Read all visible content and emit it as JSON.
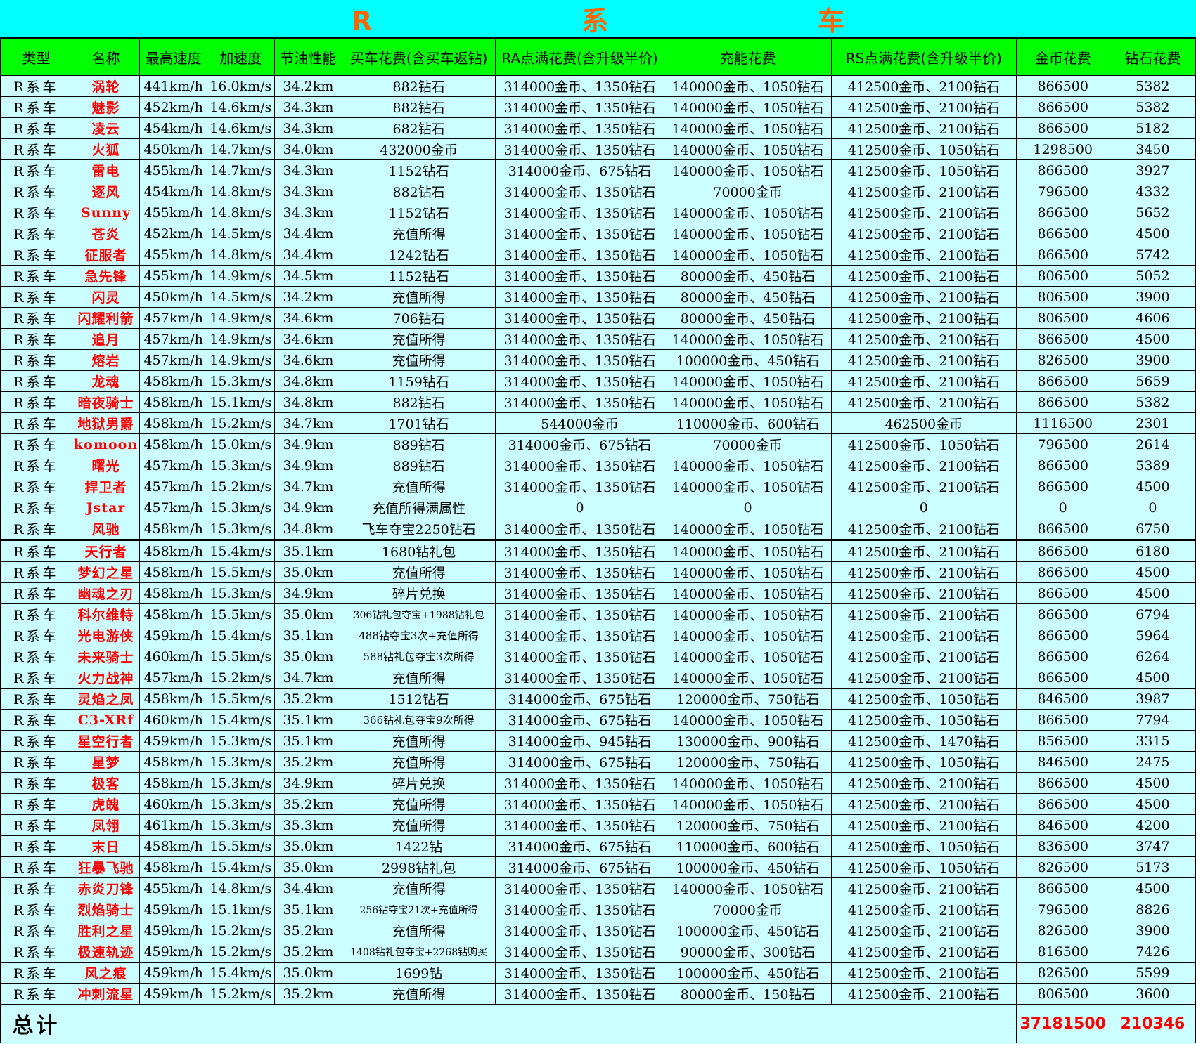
{
  "sheet": {
    "title": "R　系　车",
    "columns": [
      "类型",
      "名称",
      "最高速度",
      "加速度",
      "节油性能",
      "买车花费(含买车返钻)",
      "RA点满花费(含升级半价)",
      "充能花费",
      "RS点满花费(含升级半价)",
      "金币花费",
      "钻石花费"
    ],
    "rows": [
      {
        "type": "R系车",
        "name": "涡轮",
        "speed": "441km/h",
        "accel": "16.0km/s",
        "fuel": "34.2km",
        "buy": "882钻石",
        "ra": "314000金币、1350钻石",
        "charge": "140000金币、1050钻石",
        "rs": "412500金币、2100钻石",
        "gold": "866500",
        "diamond": "5382"
      },
      {
        "type": "R系车",
        "name": "魅影",
        "speed": "452km/h",
        "accel": "14.6km/s",
        "fuel": "34.3km",
        "buy": "882钻石",
        "ra": "314000金币、1350钻石",
        "charge": "140000金币、1050钻石",
        "rs": "412500金币、2100钻石",
        "gold": "866500",
        "diamond": "5382"
      },
      {
        "type": "R系车",
        "name": "凌云",
        "speed": "454km/h",
        "accel": "14.6km/s",
        "fuel": "34.3km",
        "buy": "682钻石",
        "ra": "314000金币、1350钻石",
        "charge": "140000金币、1050钻石",
        "rs": "412500金币、2100钻石",
        "gold": "866500",
        "diamond": "5182"
      },
      {
        "type": "R系车",
        "name": "火狐",
        "speed": "450km/h",
        "accel": "14.7km/s",
        "fuel": "34.0km",
        "buy": "432000金币",
        "ra": "314000金币、1350钻石",
        "charge": "140000金币、1050钻石",
        "rs": "412500金币、1050钻石",
        "gold": "1298500",
        "diamond": "3450"
      },
      {
        "type": "R系车",
        "name": "雷电",
        "speed": "455km/h",
        "accel": "14.7km/s",
        "fuel": "34.3km",
        "buy": "1152钻石",
        "ra": "314000金币、675钻石",
        "charge": "140000金币、1050钻石",
        "rs": "412500金币、1050钻石",
        "gold": "866500",
        "diamond": "3927"
      },
      {
        "type": "R系车",
        "name": "逐风",
        "speed": "454km/h",
        "accel": "14.8km/s",
        "fuel": "34.3km",
        "buy": "882钻石",
        "ra": "314000金币、1350钻石",
        "charge": "70000金币",
        "rs": "412500金币、2100钻石",
        "gold": "796500",
        "diamond": "4332"
      },
      {
        "type": "R系车",
        "name": "Sunny",
        "speed": "455km/h",
        "accel": "14.8km/s",
        "fuel": "34.3km",
        "buy": "1152钻石",
        "ra": "314000金币、1350钻石",
        "charge": "140000金币、1050钻石",
        "rs": "412500金币、2100钻石",
        "gold": "866500",
        "diamond": "5652"
      },
      {
        "type": "R系车",
        "name": "苍炎",
        "speed": "452km/h",
        "accel": "14.5km/s",
        "fuel": "34.4km",
        "buy": "充值所得",
        "ra": "314000金币、1350钻石",
        "charge": "140000金币、1050钻石",
        "rs": "412500金币、2100钻石",
        "gold": "866500",
        "diamond": "4500"
      },
      {
        "type": "R系车",
        "name": "征服者",
        "speed": "455km/h",
        "accel": "14.8km/s",
        "fuel": "34.4km",
        "buy": "1242钻石",
        "ra": "314000金币、1350钻石",
        "charge": "140000金币、1050钻石",
        "rs": "412500金币、2100钻石",
        "gold": "866500",
        "diamond": "5742"
      },
      {
        "type": "R系车",
        "name": "急先锋",
        "speed": "455km/h",
        "accel": "14.9km/s",
        "fuel": "34.5km",
        "buy": "1152钻石",
        "ra": "314000金币、1350钻石",
        "charge": "80000金币、450钻石",
        "rs": "412500金币、2100钻石",
        "gold": "806500",
        "diamond": "5052"
      },
      {
        "type": "R系车",
        "name": "闪灵",
        "speed": "450km/h",
        "accel": "14.5km/s",
        "fuel": "34.2km",
        "buy": "充值所得",
        "ra": "314000金币、1350钻石",
        "charge": "80000金币、450钻石",
        "rs": "412500金币、2100钻石",
        "gold": "806500",
        "diamond": "3900"
      },
      {
        "type": "R系车",
        "name": "闪耀利箭",
        "speed": "457km/h",
        "accel": "14.9km/s",
        "fuel": "34.6km",
        "buy": "706钻石",
        "ra": "314000金币、1350钻石",
        "charge": "80000金币、450钻石",
        "rs": "412500金币、2100钻石",
        "gold": "806500",
        "diamond": "4606"
      },
      {
        "type": "R系车",
        "name": "追月",
        "speed": "457km/h",
        "accel": "14.9km/s",
        "fuel": "34.6km",
        "buy": "充值所得",
        "ra": "314000金币、1350钻石",
        "charge": "140000金币、1050钻石",
        "rs": "412500金币、2100钻石",
        "gold": "866500",
        "diamond": "4500"
      },
      {
        "type": "R系车",
        "name": "熔岩",
        "speed": "457km/h",
        "accel": "14.9km/s",
        "fuel": "34.6km",
        "buy": "充值所得",
        "ra": "314000金币、1350钻石",
        "charge": "100000金币、450钻石",
        "rs": "412500金币、2100钻石",
        "gold": "826500",
        "diamond": "3900"
      },
      {
        "type": "R系车",
        "name": "龙魂",
        "speed": "458km/h",
        "accel": "15.3km/s",
        "fuel": "34.8km",
        "buy": "1159钻石",
        "ra": "314000金币、1350钻石",
        "charge": "140000金币、1050钻石",
        "rs": "412500金币、2100钻石",
        "gold": "866500",
        "diamond": "5659"
      },
      {
        "type": "R系车",
        "name": "暗夜骑士",
        "speed": "458km/h",
        "accel": "15.1km/s",
        "fuel": "34.8km",
        "buy": "882钻石",
        "ra": "314000金币、1350钻石",
        "charge": "140000金币、1050钻石",
        "rs": "412500金币、2100钻石",
        "gold": "866500",
        "diamond": "5382"
      },
      {
        "type": "R系车",
        "name": "地狱男爵",
        "speed": "458km/h",
        "accel": "15.2km/s",
        "fuel": "34.7km",
        "buy": "1701钻石",
        "ra": "544000金币",
        "charge": "110000金币、600钻石",
        "rs": "462500金币",
        "gold": "1116500",
        "diamond": "2301"
      },
      {
        "type": "R系车",
        "name": "komoon",
        "speed": "458km/h",
        "accel": "15.0km/s",
        "fuel": "34.9km",
        "buy": "889钻石",
        "ra": "314000金币、675钻石",
        "charge": "70000金币",
        "rs": "412500金币、1050钻石",
        "gold": "796500",
        "diamond": "2614"
      },
      {
        "type": "R系车",
        "name": "曙光",
        "speed": "457km/h",
        "accel": "15.3km/s",
        "fuel": "34.9km",
        "buy": "889钻石",
        "ra": "314000金币、1350钻石",
        "charge": "140000金币、1050钻石",
        "rs": "412500金币、2100钻石",
        "gold": "866500",
        "diamond": "5389"
      },
      {
        "type": "R系车",
        "name": "捍卫者",
        "speed": "457km/h",
        "accel": "15.2km/s",
        "fuel": "34.7km",
        "buy": "充值所得",
        "ra": "314000金币、1350钻石",
        "charge": "140000金币、1050钻石",
        "rs": "412500金币、2100钻石",
        "gold": "866500",
        "diamond": "4500"
      },
      {
        "type": "R系车",
        "name": "Jstar",
        "speed": "457km/h",
        "accel": "15.3km/s",
        "fuel": "34.9km",
        "buy": "充值所得满属性",
        "ra": "0",
        "charge": "0",
        "rs": "0",
        "gold": "0",
        "diamond": "0"
      },
      {
        "type": "R系车",
        "name": "风驰",
        "speed": "458km/h",
        "accel": "15.3km/s",
        "fuel": "34.8km",
        "buy": "飞车夺宝2250钻石",
        "ra": "314000金币、1350钻石",
        "charge": "140000金币、1050钻石",
        "rs": "412500金币、2100钻石",
        "gold": "866500",
        "diamond": "6750"
      },
      {
        "type": "R系车",
        "name": "天行者",
        "speed": "458km/h",
        "accel": "15.4km/s",
        "fuel": "35.1km",
        "buy": "1680钻礼包",
        "ra": "314000金币、1350钻石",
        "charge": "140000金币、1050钻石",
        "rs": "412500金币、2100钻石",
        "gold": "866500",
        "diamond": "6180"
      },
      {
        "type": "R系车",
        "name": "梦幻之星",
        "speed": "458km/h",
        "accel": "15.5km/s",
        "fuel": "35.0km",
        "buy": "充值所得",
        "ra": "314000金币、1350钻石",
        "charge": "140000金币、1050钻石",
        "rs": "412500金币、2100钻石",
        "gold": "866500",
        "diamond": "4500"
      },
      {
        "type": "R系车",
        "name": "幽魂之刃",
        "speed": "458km/h",
        "accel": "15.3km/s",
        "fuel": "34.9km",
        "buy": "碎片兑换",
        "ra": "314000金币、1350钻石",
        "charge": "140000金币、1050钻石",
        "rs": "412500金币、2100钻石",
        "gold": "866500",
        "diamond": "4500"
      },
      {
        "type": "R系车",
        "name": "科尔维特",
        "speed": "458km/h",
        "accel": "15.5km/s",
        "fuel": "35.0km",
        "buy": "306钻礼包夺宝+1988钻礼包",
        "ra": "314000金币、1350钻石",
        "charge": "140000金币、1050钻石",
        "rs": "412500金币、2100钻石",
        "gold": "866500",
        "diamond": "6794"
      },
      {
        "type": "R系车",
        "name": "光电游侠",
        "speed": "459km/h",
        "accel": "15.4km/s",
        "fuel": "35.1km",
        "buy": "488钻夺宝3次+充值所得",
        "ra": "314000金币、1350钻石",
        "charge": "140000金币、1050钻石",
        "rs": "412500金币、2100钻石",
        "gold": "866500",
        "diamond": "5964"
      },
      {
        "type": "R系车",
        "name": "未来骑士",
        "speed": "460km/h",
        "accel": "15.5km/s",
        "fuel": "35.0km",
        "buy": "588钻礼包夺宝3次所得",
        "ra": "314000金币、1350钻石",
        "charge": "140000金币、1050钻石",
        "rs": "412500金币、2100钻石",
        "gold": "866500",
        "diamond": "6264"
      },
      {
        "type": "R系车",
        "name": "火力战神",
        "speed": "457km/h",
        "accel": "15.2km/s",
        "fuel": "34.7km",
        "buy": "充值所得",
        "ra": "314000金币、1350钻石",
        "charge": "140000金币、1050钻石",
        "rs": "412500金币、2100钻石",
        "gold": "866500",
        "diamond": "4500"
      },
      {
        "type": "R系车",
        "name": "灵焰之凤",
        "speed": "458km/h",
        "accel": "15.5km/s",
        "fuel": "35.2km",
        "buy": "1512钻石",
        "ra": "314000金币、675钻石",
        "charge": "120000金币、750钻石",
        "rs": "412500金币、1050钻石",
        "gold": "846500",
        "diamond": "3987"
      },
      {
        "type": "R系车",
        "name": "C3-XRf",
        "speed": "460km/h",
        "accel": "15.4km/s",
        "fuel": "35.1km",
        "buy": "366钻礼包夺宝9次所得",
        "ra": "314000金币、675钻石",
        "charge": "140000金币、1050钻石",
        "rs": "412500金币、1050钻石",
        "gold": "866500",
        "diamond": "7794"
      },
      {
        "type": "R系车",
        "name": "星空行者",
        "speed": "459km/h",
        "accel": "15.3km/s",
        "fuel": "35.1km",
        "buy": "充值所得",
        "ra": "314000金币、945钻石",
        "charge": "130000金币、900钻石",
        "rs": "412500金币、1470钻石",
        "gold": "856500",
        "diamond": "3315"
      },
      {
        "type": "R系车",
        "name": "星梦",
        "speed": "458km/h",
        "accel": "15.3km/s",
        "fuel": "35.2km",
        "buy": "充值所得",
        "ra": "314000金币、675钻石",
        "charge": "120000金币、750钻石",
        "rs": "412500金币、1050钻石",
        "gold": "846500",
        "diamond": "2475"
      },
      {
        "type": "R系车",
        "name": "极客",
        "speed": "458km/h",
        "accel": "15.3km/s",
        "fuel": "34.9km",
        "buy": "碎片兑换",
        "ra": "314000金币、1350钻石",
        "charge": "140000金币、1050钻石",
        "rs": "412500金币、2100钻石",
        "gold": "866500",
        "diamond": "4500"
      },
      {
        "type": "R系车",
        "name": "虎魄",
        "speed": "460km/h",
        "accel": "15.3km/s",
        "fuel": "35.2km",
        "buy": "充值所得",
        "ra": "314000金币、1350钻石",
        "charge": "140000金币、1050钻石",
        "rs": "412500金币、2100钻石",
        "gold": "866500",
        "diamond": "4500"
      },
      {
        "type": "R系车",
        "name": "凤翎",
        "speed": "461km/h",
        "accel": "15.3km/s",
        "fuel": "35.3km",
        "buy": "充值所得",
        "ra": "314000金币、1350钻石",
        "charge": "120000金币、750钻石",
        "rs": "412500金币、2100钻石",
        "gold": "846500",
        "diamond": "4200"
      },
      {
        "type": "R系车",
        "name": "末日",
        "speed": "458km/h",
        "accel": "15.5km/s",
        "fuel": "35.0km",
        "buy": "1422钻",
        "ra": "314000金币、675钻石",
        "charge": "110000金币、600钻石",
        "rs": "412500金币、1050钻石",
        "gold": "836500",
        "diamond": "3747"
      },
      {
        "type": "R系车",
        "name": "狂暴飞驰",
        "speed": "458km/h",
        "accel": "15.4km/s",
        "fuel": "35.0km",
        "buy": "2998钻礼包",
        "ra": "314000金币、675钻石",
        "charge": "100000金币、450钻石",
        "rs": "412500金币、1050钻石",
        "gold": "826500",
        "diamond": "5173"
      },
      {
        "type": "R系车",
        "name": "赤炎刀锋",
        "speed": "455km/h",
        "accel": "14.8km/s",
        "fuel": "34.4km",
        "buy": "充值所得",
        "ra": "314000金币、1350钻石",
        "charge": "140000金币、1050钻石",
        "rs": "412500金币、2100钻石",
        "gold": "866500",
        "diamond": "4500"
      },
      {
        "type": "R系车",
        "name": "烈焰骑士",
        "speed": "459km/h",
        "accel": "15.1km/s",
        "fuel": "35.1km",
        "buy": "256钻夺宝21次+充值所得",
        "ra": "314000金币、1350钻石",
        "charge": "70000金币",
        "rs": "412500金币、2100钻石",
        "gold": "796500",
        "diamond": "8826"
      },
      {
        "type": "R系车",
        "name": "胜利之星",
        "speed": "459km/h",
        "accel": "15.2km/s",
        "fuel": "35.2km",
        "buy": "充值所得",
        "ra": "314000金币、1350钻石",
        "charge": "100000金币、450钻石",
        "rs": "412500金币、2100钻石",
        "gold": "826500",
        "diamond": "3900"
      },
      {
        "type": "R系车",
        "name": "极速轨迹",
        "speed": "459km/h",
        "accel": "15.2km/s",
        "fuel": "35.2km",
        "buy": "1408钻礼包夺宝+2268钻购买",
        "ra": "314000金币、1350钻石",
        "charge": "90000金币、300钻石",
        "rs": "412500金币、2100钻石",
        "gold": "816500",
        "diamond": "7426"
      },
      {
        "type": "R系车",
        "name": "风之痕",
        "speed": "459km/h",
        "accel": "15.4km/s",
        "fuel": "35.0km",
        "buy": "1699钻",
        "ra": "314000金币、1350钻石",
        "charge": "100000金币、450钻石",
        "rs": "412500金币、2100钻石",
        "gold": "826500",
        "diamond": "5599"
      },
      {
        "type": "R系车",
        "name": "冲刺流星",
        "speed": "459km/h",
        "accel": "15.2km/s",
        "fuel": "35.2km",
        "buy": "充值所得",
        "ra": "314000金币、1350钻石",
        "charge": "80000金币、150钻石",
        "rs": "412500金币、2100钻石",
        "gold": "806500",
        "diamond": "3600"
      }
    ],
    "total": {
      "label": "总计",
      "gold": "37181500",
      "diamond": "210346"
    }
  }
}
